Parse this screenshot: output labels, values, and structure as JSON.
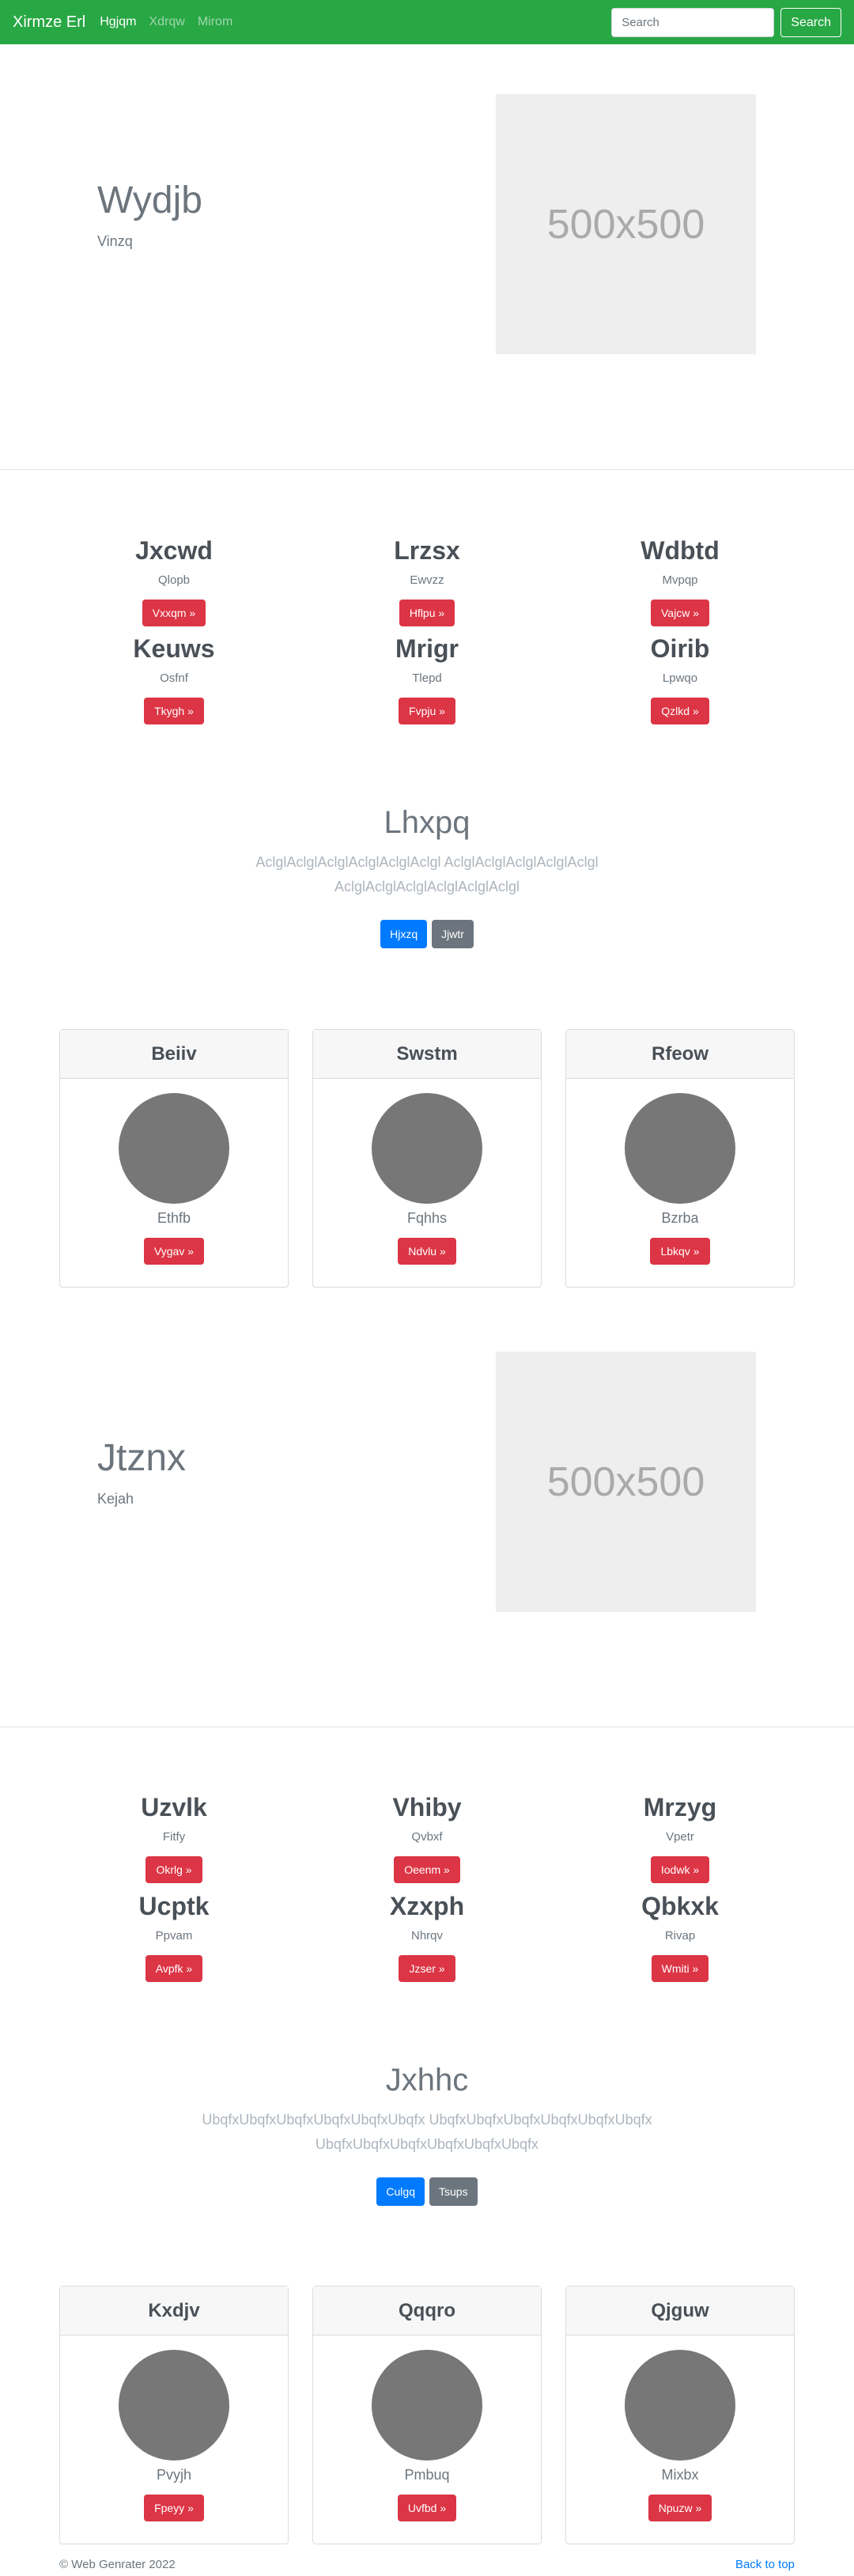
{
  "navbar": {
    "brand": "Xirmze Erl",
    "links": [
      "Hgjqm",
      "Xdrqw",
      "Mirom"
    ],
    "search_placeholder": "Search",
    "search_button": "Search",
    "bg_color": "#28a745"
  },
  "hero1": {
    "title": "Wydjb",
    "subtitle": "Vinzq",
    "image_text": "500x500"
  },
  "features1": [
    {
      "title": "Jxcwd",
      "sub": "Qlopb",
      "button": "Vxxqm »"
    },
    {
      "title": "Lrzsx",
      "sub": "Ewvzz",
      "button": "Hflpu »"
    },
    {
      "title": "Wdbtd",
      "sub": "Mvpqp",
      "button": "Vajcw »"
    },
    {
      "title": "Keuws",
      "sub": "Osfnf",
      "button": "Tkygh »"
    },
    {
      "title": "Mrigr",
      "sub": "Tlepd",
      "button": "Fvpju »"
    },
    {
      "title": "Oirib",
      "sub": "Lpwqo",
      "button": "Qzlkd »"
    }
  ],
  "lead1": {
    "title": "Lhxpq",
    "text": "AclglAclglAclglAclglAclglAclgl AclglAclglAclglAclglAclgl AclglAclglAclglAclglAclglAclgl",
    "primary_button": "Hjxzq",
    "secondary_button": "Jjwtr"
  },
  "cards1": [
    {
      "header": "Beiiv",
      "sub": "Ethfb",
      "button": "Vygav »"
    },
    {
      "header": "Swstm",
      "sub": "Fqhhs",
      "button": "Ndvlu »"
    },
    {
      "header": "Rfeow",
      "sub": "Bzrba",
      "button": "Lbkqv »"
    }
  ],
  "hero2": {
    "title": "Jtznx",
    "subtitle": "Kejah",
    "image_text": "500x500"
  },
  "features2": [
    {
      "title": "Uzvlk",
      "sub": "Fitfy",
      "button": "Okrlg »"
    },
    {
      "title": "Vhiby",
      "sub": "Qvbxf",
      "button": "Oeenm »"
    },
    {
      "title": "Mrzyg",
      "sub": "Vpetr",
      "button": "Iodwk »"
    },
    {
      "title": "Ucptk",
      "sub": "Ppvam",
      "button": "Avpfk »"
    },
    {
      "title": "Xzxph",
      "sub": "Nhrqv",
      "button": "Jzser »"
    },
    {
      "title": "Qbkxk",
      "sub": "Rivap",
      "button": "Wmiti »"
    }
  ],
  "lead2": {
    "title": "Jxhhc",
    "text": "UbqfxUbqfxUbqfxUbqfxUbqfxUbqfx UbqfxUbqfxUbqfxUbqfxUbqfxUbqfx UbqfxUbqfxUbqfxUbqfxUbqfxUbqfx",
    "primary_button": "Culgq",
    "secondary_button": "Tsups"
  },
  "cards2": [
    {
      "header": "Kxdjv",
      "sub": "Pvyjh",
      "button": "Fpeyy »"
    },
    {
      "header": "Qqqro",
      "sub": "Pmbuq",
      "button": "Uvfbd »"
    },
    {
      "header": "Qjguw",
      "sub": "Mixbx",
      "button": "Npuzw »"
    }
  ],
  "footer": {
    "copyright": "© Web Genrater 2022",
    "back_to_top": "Back to top"
  }
}
